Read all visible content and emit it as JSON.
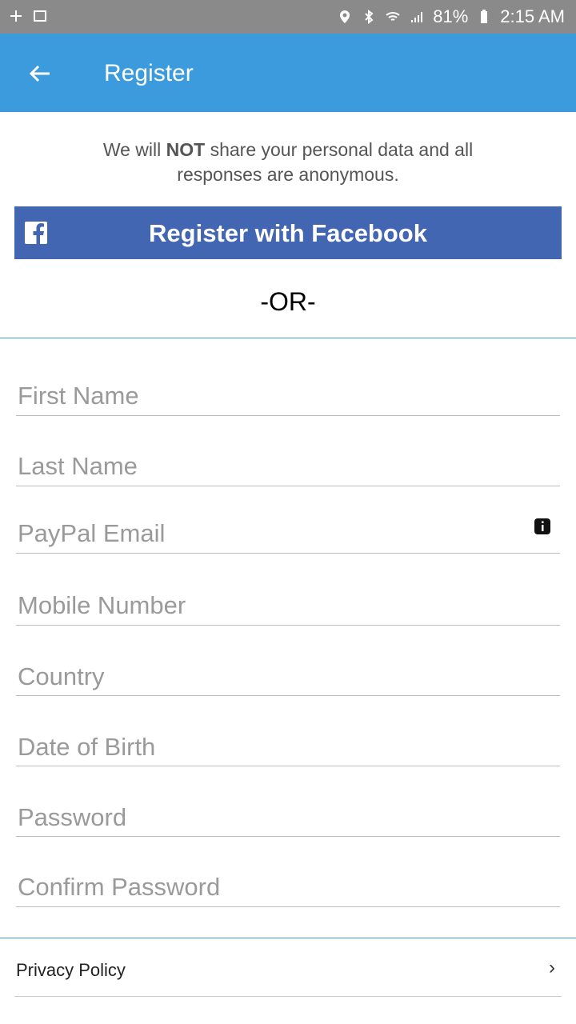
{
  "statusbar": {
    "battery": "81%",
    "time": "2:15 AM"
  },
  "appbar": {
    "title": "Register"
  },
  "notice": {
    "prefix": "We will ",
    "emphasis": "NOT",
    "suffix": " share your personal data and all responses are anonymous."
  },
  "facebook_button": {
    "label": "Register with Facebook"
  },
  "separator": {
    "text": "-OR-"
  },
  "form": {
    "first_name": "First Name",
    "last_name": "Last Name",
    "paypal_email": "PayPal Email",
    "mobile_number": "Mobile Number",
    "country": "Country",
    "date_of_birth": "Date of Birth",
    "password": "Password",
    "confirm_password": "Confirm Password"
  },
  "privacy": {
    "label": "Privacy Policy",
    "chevron": "›"
  },
  "colors": {
    "appbar": "#3b9bdc",
    "facebook": "#4266b2",
    "statusbar": "#8a8a8a"
  }
}
